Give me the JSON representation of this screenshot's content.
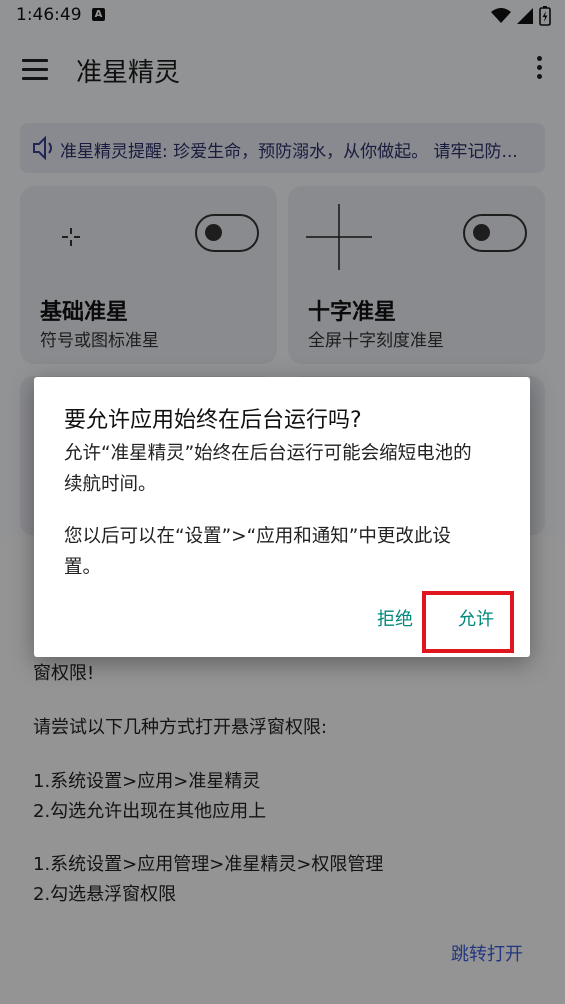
{
  "status_bar": {
    "time": "1:46:49",
    "a_badge": "A",
    "icons": [
      "wifi-icon",
      "signal-icon",
      "battery-charging-icon"
    ]
  },
  "app_bar": {
    "title": "准星精灵",
    "menu_icon": "hamburger-menu-icon",
    "overflow_icon": "more-vert-icon"
  },
  "notice": {
    "icon": "speaker-icon",
    "text": "准星精灵提醒: 珍爱生命，预防溺水，从你做起。 请牢记防..."
  },
  "cards": [
    {
      "title": "基础准星",
      "subtitle": "符号或图标准星",
      "icon": "small-crosshair-icon",
      "toggle_on": false
    },
    {
      "title": "十字准星",
      "subtitle": "全屏十字刻度准星",
      "icon": "large-crosshair-icon",
      "toggle_on": false
    }
  ],
  "sheet": {
    "lines": [
      "窗权限!",
      "请尝试以下几种方式打开悬浮窗权限:",
      "1.系统设置>应用>准星精灵",
      "2.勾选允许出现在其他应用上",
      "1.系统设置>应用管理>准星精灵>权限管理",
      "2.勾选悬浮窗权限"
    ],
    "jump_button": "跳转打开"
  },
  "dialog": {
    "title": "要允许应用始终在后台运行吗?",
    "message_1_line1": "允许“准星精灵”始终在后台运行可能会缩短电池的",
    "message_1_line2": "续航时间。",
    "message_2_line1": "您以后可以在“设置”>“应用和通知”中更改此设",
    "message_2_line2": "置。",
    "deny_button": "拒绝",
    "allow_button": "允许"
  },
  "colors": {
    "dialog_button": "#00897b",
    "highlight_box": "#e0161e",
    "link": "#3b5bd6"
  }
}
